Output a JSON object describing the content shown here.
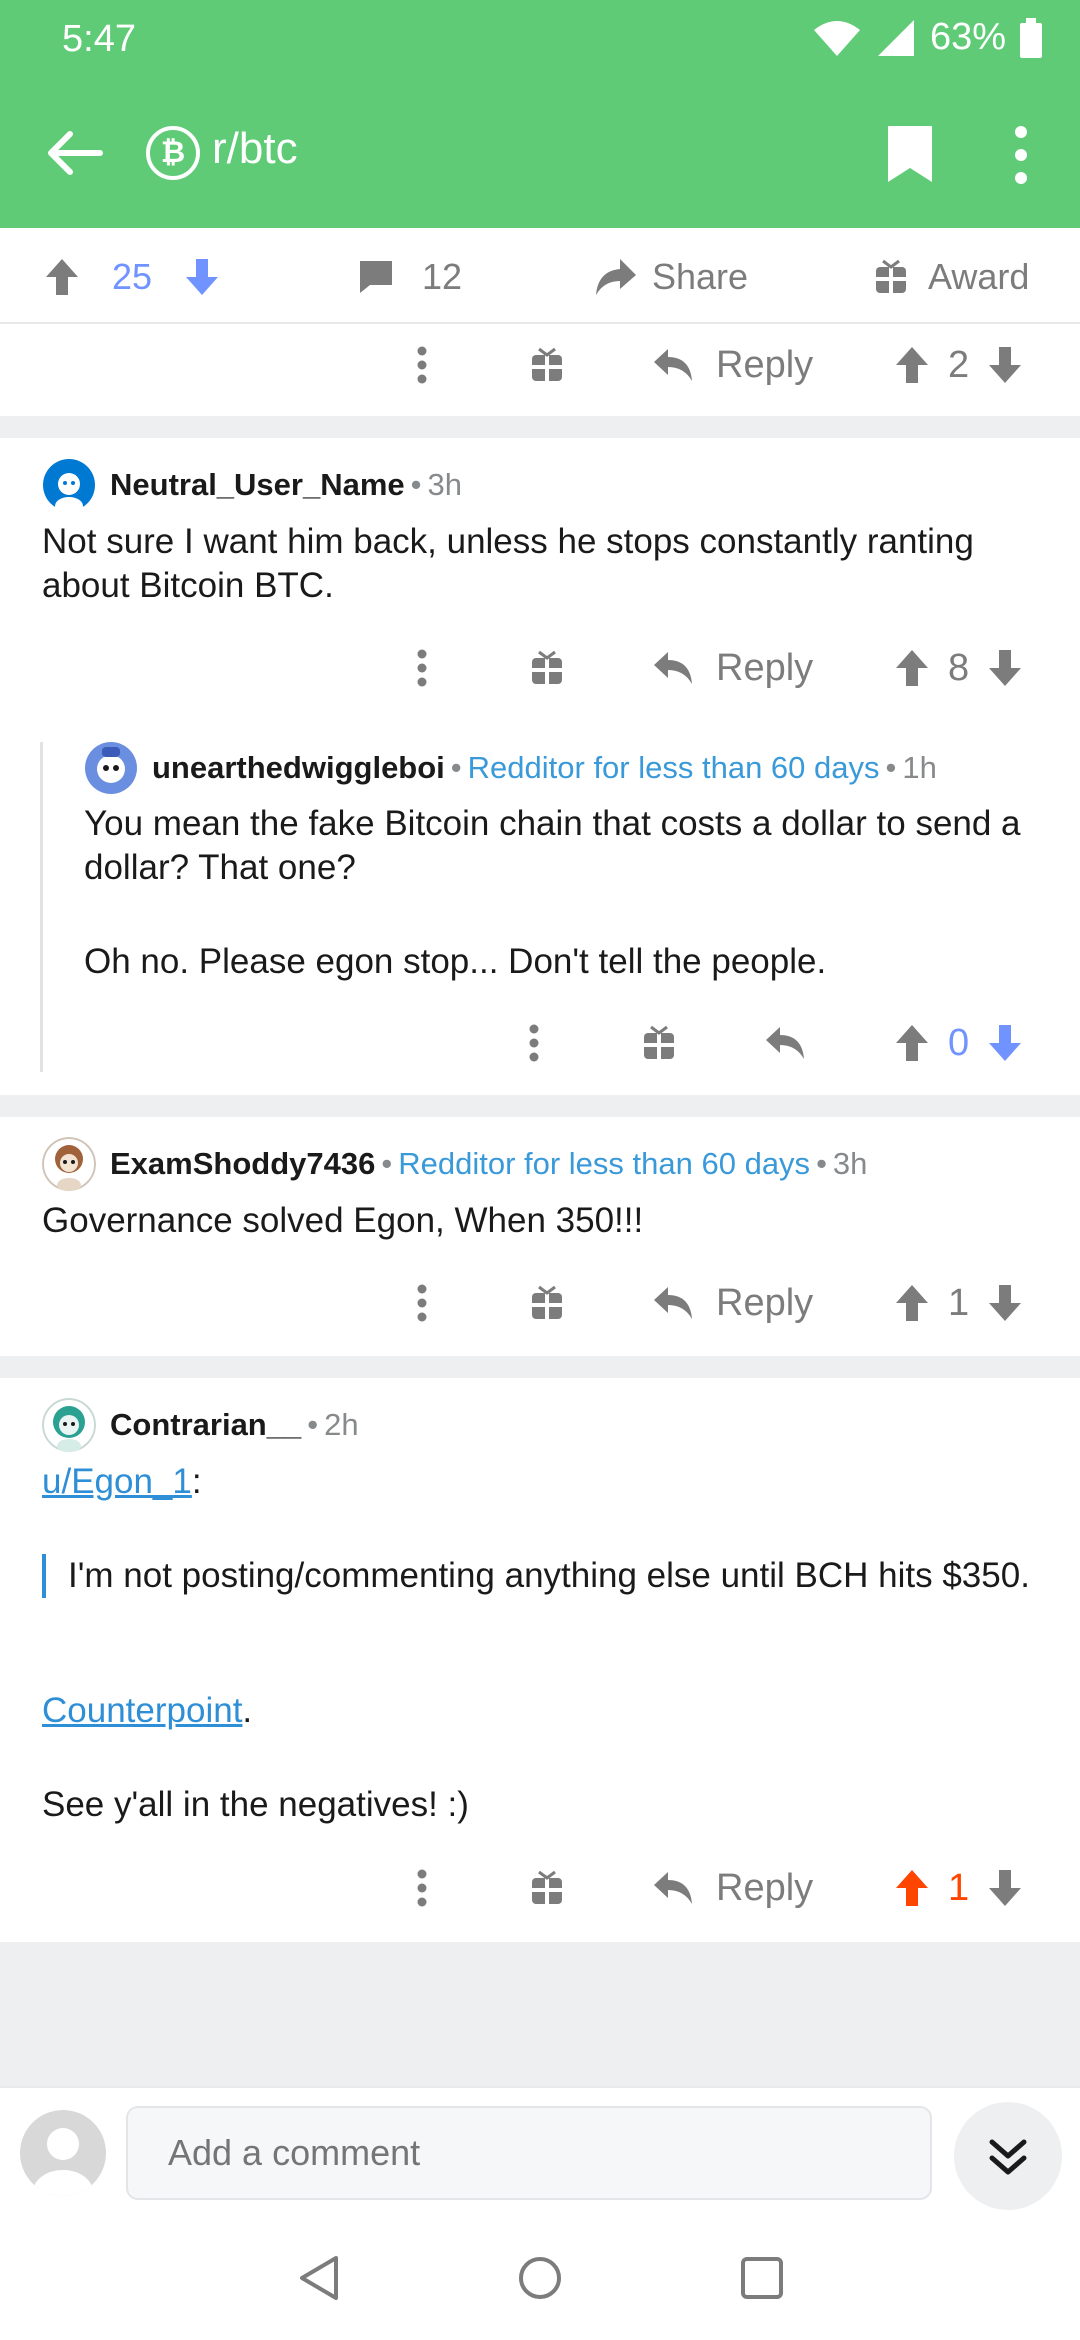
{
  "status": {
    "time": "5:47",
    "battery": "63%"
  },
  "header": {
    "subreddit": "r/btc",
    "sub_icon": "₿"
  },
  "post_bar": {
    "score": "25",
    "comments": "12",
    "share": "Share",
    "award": "Award"
  },
  "actions_top": {
    "reply": "Reply",
    "score": "2"
  },
  "comments": [
    {
      "author": "Neutral_User_Name",
      "time": "3h",
      "text": "Not sure I want him back, unless he stops constantly ranting about Bitcoin BTC.",
      "reply": "Reply",
      "score": "8"
    },
    {
      "author": "unearthedwiggleboi",
      "flair": "Redditor for less than 60 days",
      "time": "1h",
      "text1": "You mean the fake Bitcoin chain that costs a dollar to send a dollar? That one?",
      "text2": "Oh no. Please egon stop... Don't tell the people.",
      "score": "0"
    },
    {
      "author": "ExamShoddy7436",
      "flair": "Redditor for less than 60 days",
      "time": "3h",
      "text": "Governance solved Egon, When 350!!!",
      "reply": "Reply",
      "score": "1"
    },
    {
      "author": "Contrarian__",
      "time": "2h",
      "mention": "u/Egon_1",
      "mention_suffix": ":",
      "quote": "I'm not posting/commenting anything else until BCH hits $350.",
      "link": "Counterpoint",
      "link_suffix": ".",
      "closing": "See y'all in the negatives! :)",
      "reply": "Reply",
      "score": "1"
    }
  ],
  "compose": {
    "placeholder": "Add a comment"
  },
  "colors": {
    "header_green": "#5fcb77",
    "upvote_orange": "#ff4500",
    "downvote_blue": "#7193ff",
    "flair_blue": "#3a9ad9"
  },
  "icons": [
    "back-arrow-icon",
    "bitcoin-icon",
    "bookmark-icon",
    "more-vert-icon",
    "upvote-icon",
    "downvote-icon",
    "comment-icon",
    "share-icon",
    "gift-icon",
    "reply-icon",
    "avatar-icon",
    "double-chevron-down-icon",
    "nav-back-icon",
    "nav-home-icon",
    "nav-recents-icon"
  ]
}
